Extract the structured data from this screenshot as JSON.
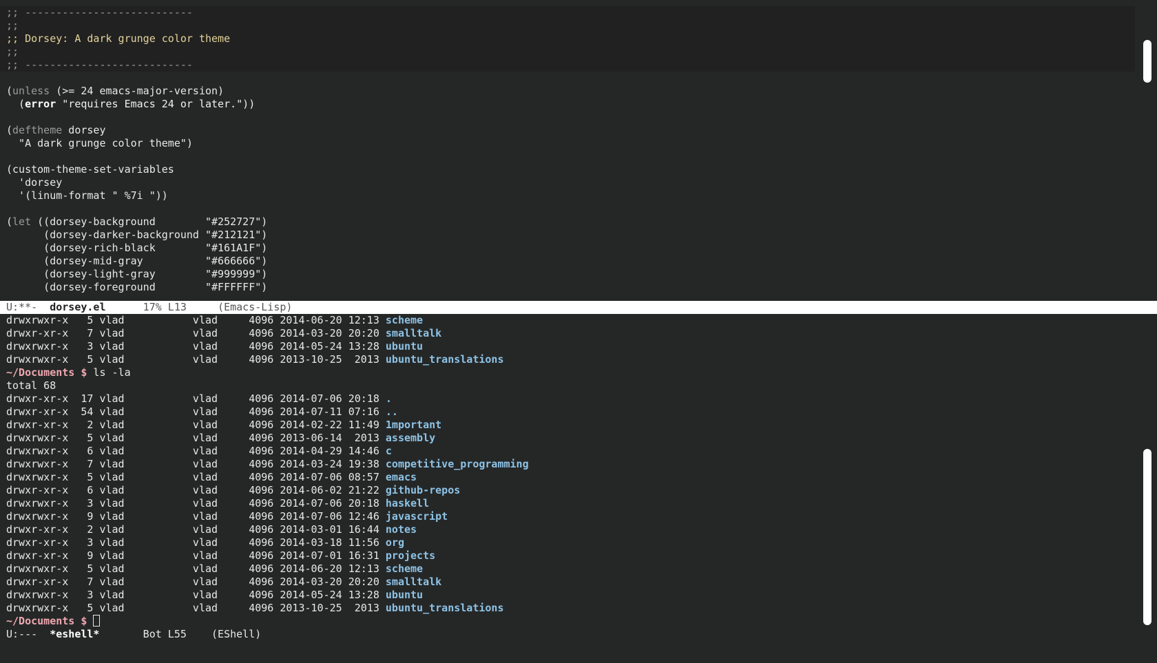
{
  "editor": {
    "comment_lines": [
      ";; ---------------------------",
      ";;",
      ";; Dorsey: A dark grunge color theme",
      ";;",
      ";; ---------------------------"
    ],
    "code": {
      "unless_kw": "unless",
      "unless_rest": " (>= 24 emacs-major-version)",
      "error_kw": "error",
      "error_str": " \"requires Emacs 24 or later.\"))",
      "deftheme_kw": "deftheme",
      "deftheme_name": " dorsey",
      "deftheme_doc": "  \"A dark grunge color theme\")",
      "custom_line": "(custom-theme-set-variables",
      "quote_dorsey": "  'dorsey",
      "linum_line": "  '(linum-format \" %7i \"))",
      "let_kw": "let",
      "let_rest": " ((dorsey-background        \"#252727\")",
      "vars": [
        "      (dorsey-darker-background \"#212121\")",
        "      (dorsey-rich-black        \"#161A1F\")",
        "      (dorsey-mid-gray          \"#666666\")",
        "      (dorsey-light-gray        \"#999999\")",
        "      (dorsey-foreground        \"#FFFFFF\")"
      ]
    }
  },
  "modeline_top": {
    "state": "U:**-  ",
    "buffer": "dorsey.el",
    "position": "      17% L13     ",
    "mode": "(Emacs-Lisp)"
  },
  "shell": {
    "pre_rows": [
      {
        "info": "drwxrwxr-x   5 vlad           vlad     4096 2014-06-20 12:13 ",
        "name": "scheme"
      },
      {
        "info": "drwxr-xr-x   7 vlad           vlad     4096 2014-03-20 20:20 ",
        "name": "smalltalk"
      },
      {
        "info": "drwxrwxr-x   3 vlad           vlad     4096 2014-05-24 13:28 ",
        "name": "ubuntu"
      },
      {
        "info": "drwxrwxr-x   5 vlad           vlad     4096 2013-10-25  2013 ",
        "name": "ubuntu_translations"
      }
    ],
    "prompt_path": "~/Documents $",
    "command": " ls -la",
    "total": "total 68",
    "rows": [
      {
        "info": "drwxr-xr-x  17 vlad           vlad     4096 2014-07-06 20:18 ",
        "name": "."
      },
      {
        "info": "drwxr-xr-x  54 vlad           vlad     4096 2014-07-11 07:16 ",
        "name": ".."
      },
      {
        "info": "drwxr-xr-x   2 vlad           vlad     4096 2014-02-22 11:49 ",
        "name": "1mportant"
      },
      {
        "info": "drwxrwxr-x   5 vlad           vlad     4096 2013-06-14  2013 ",
        "name": "assembly"
      },
      {
        "info": "drwxrwxr-x   6 vlad           vlad     4096 2014-04-29 14:46 ",
        "name": "c"
      },
      {
        "info": "drwxrwxr-x   7 vlad           vlad     4096 2014-03-24 19:38 ",
        "name": "competitive_programming"
      },
      {
        "info": "drwxrwxr-x   5 vlad           vlad     4096 2014-07-06 08:57 ",
        "name": "emacs"
      },
      {
        "info": "drwxr-xr-x   6 vlad           vlad     4096 2014-06-02 21:22 ",
        "name": "github-repos"
      },
      {
        "info": "drwxrwxr-x   3 vlad           vlad     4096 2014-07-06 20:18 ",
        "name": "haskell"
      },
      {
        "info": "drwxrwxr-x   9 vlad           vlad     4096 2014-07-06 12:46 ",
        "name": "javascript"
      },
      {
        "info": "drwxr-xr-x   2 vlad           vlad     4096 2014-03-01 16:44 ",
        "name": "notes"
      },
      {
        "info": "drwxr-xr-x   3 vlad           vlad     4096 2014-03-18 11:56 ",
        "name": "org"
      },
      {
        "info": "drwxr-xr-x   9 vlad           vlad     4096 2014-07-01 16:31 ",
        "name": "projects"
      },
      {
        "info": "drwxrwxr-x   5 vlad           vlad     4096 2014-06-20 12:13 ",
        "name": "scheme"
      },
      {
        "info": "drwxr-xr-x   7 vlad           vlad     4096 2014-03-20 20:20 ",
        "name": "smalltalk"
      },
      {
        "info": "drwxrwxr-x   3 vlad           vlad     4096 2014-05-24 13:28 ",
        "name": "ubuntu"
      },
      {
        "info": "drwxrwxr-x   5 vlad           vlad     4096 2013-10-25  2013 ",
        "name": "ubuntu_translations"
      }
    ],
    "final_prompt": "~/Documents $"
  },
  "modeline_bottom": {
    "state": "U:---  ",
    "buffer": "*eshell*",
    "position": "       Bot L55    ",
    "mode": "(EShell)"
  },
  "colors": {
    "background": "#252727",
    "darker_background": "#212121",
    "directory": "#8ec3e6",
    "prompt": "#f0a8b0",
    "comment_title": "#e3d39a"
  }
}
